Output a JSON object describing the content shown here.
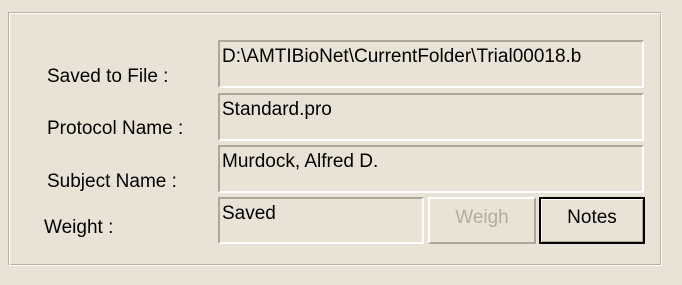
{
  "labels": {
    "saved_to_file": "Saved to File :",
    "protocol_name": "Protocol Name :",
    "subject_name": "Subject Name :",
    "weight": "Weight :"
  },
  "fields": {
    "saved_to_file": "D:\\AMTIBioNet\\CurrentFolder\\Trial00018.b",
    "protocol_name": "Standard.pro",
    "subject_name": "Murdock, Alfred D.",
    "weight": "Saved"
  },
  "buttons": {
    "weigh_label": "Weigh",
    "weigh_enabled": false,
    "notes_label": "Notes"
  }
}
